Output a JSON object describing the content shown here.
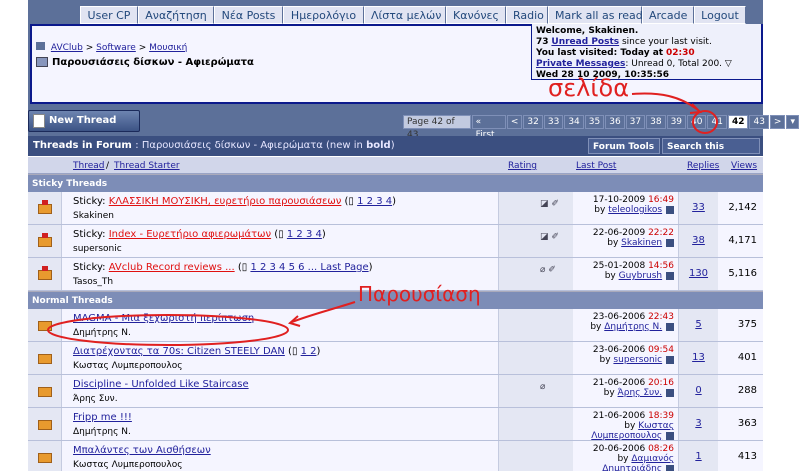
{
  "nav": [
    "User CP",
    "Αναζήτηση",
    "Νέα Posts",
    "Ημερολόγιο",
    "Λίστα μελών",
    "Κανόνες",
    "Radio",
    "Mark all as read",
    "Arcade",
    "Logout"
  ],
  "breadcrumb": {
    "home": "AVClub",
    "l1": "Software",
    "l2": "Μουσική",
    "title": "Παρουσιάσεις δίσκων - Αφιερώματα"
  },
  "welcome": {
    "line1": "Welcome, Skakinen.",
    "unread_count": "73",
    "unread_link": "Unread Posts",
    "unread_suffix": "since your last visit.",
    "visited_prefix": "You last visited: Today at",
    "visited_time": "02:30",
    "pm_link": "Private Messages",
    "pm_status": ": Unread 0, Total 200.",
    "datetime": "Wed 28 10 2009, 10:35:56"
  },
  "toolbar": {
    "new_thread": "New Thread"
  },
  "pager": {
    "label": "Page 42 of 43",
    "first": "« First",
    "prev": "<",
    "pages": [
      "32",
      "33",
      "34",
      "35",
      "36",
      "37",
      "38",
      "39",
      "40",
      "41"
    ],
    "current": "42",
    "next_page": "43",
    "next": ">"
  },
  "forum": {
    "title": "Threads in Forum",
    "subtitle_prefix": ": Παρουσιάσεις δίσκων - Αφιερώματα (new in",
    "subtitle_bold": "bold",
    "subtitle_suffix": ")",
    "tools": "Forum Tools",
    "search": "Search this Forum"
  },
  "columns": {
    "thread": "Thread",
    "sep": "/",
    "starter": "Thread Starter",
    "rating": "Rating",
    "last_post": "Last Post",
    "replies": "Replies",
    "views": "Views"
  },
  "sections": {
    "sticky": "Sticky Threads",
    "normal": "Normal Threads"
  },
  "sticky": [
    {
      "prefix": "Sticky:",
      "title": "ΚΛΑΣΣΙΚΗ ΜΟΥΣΙΚΗ, ευρετήριο παρουσιάσεων",
      "pages": "1 2 3 4",
      "author": "Skakinen",
      "date": "17-10-2009",
      "time": "16:49",
      "by": "teleologikos",
      "replies": "33",
      "views": "2,142"
    },
    {
      "prefix": "Sticky:",
      "title": "Index - Ευρετήριο αφιερωμάτων",
      "pages": "1 2 3 4",
      "author": "supersonic",
      "date": "22-06-2009",
      "time": "22:22",
      "by": "Skakinen",
      "replies": "38",
      "views": "4,171"
    },
    {
      "prefix": "Sticky:",
      "title": "AVclub Record reviews ...",
      "pages": "1 2 3 4 5 6 ... Last Page",
      "author": "Tasos_Th",
      "date": "25-01-2008",
      "time": "14:56",
      "by": "Guybrush",
      "replies": "130",
      "views": "5,116"
    }
  ],
  "normal": [
    {
      "title": "MAGMA - Μια ξεχωριστή περίπτωση",
      "pages": "",
      "author": "Δημήτρης Ν.",
      "date": "23-06-2006",
      "time": "22:43",
      "by": "Δημήτρης Ν.",
      "replies": "5",
      "views": "375"
    },
    {
      "title": "Διατρέχοντας τα 70s: Citizen STEELY DAN",
      "pages": "1 2",
      "author": "Κωστας Λυμπεροπουλος",
      "date": "23-06-2006",
      "time": "09:54",
      "by": "supersonic",
      "replies": "13",
      "views": "401"
    },
    {
      "title": "Discipline - Unfolded Like Staircase",
      "pages": "",
      "author": "Άρης Συν.",
      "date": "21-06-2006",
      "time": "20:16",
      "by": "Άρης Συν.",
      "replies": "0",
      "views": "288"
    },
    {
      "title": "Fripp me !!!",
      "pages": "",
      "author": "Δημήτρης Ν.",
      "date": "21-06-2006",
      "time": "18:39",
      "by": "Κωστας Λυμπεροπουλος",
      "replies": "3",
      "views": "363"
    },
    {
      "title": "Μπαλάντες των Αισθήσεων",
      "pages": "",
      "author": "Κωστας Λυμπεροπουλος",
      "date": "20-06-2006",
      "time": "08:26",
      "by": "Δαμιανός Δημητριάδης",
      "replies": "1",
      "views": "413"
    }
  ],
  "annotations": {
    "page": "σελίδα",
    "presentation": "Παρουσίαση",
    "color": "#e02020"
  }
}
